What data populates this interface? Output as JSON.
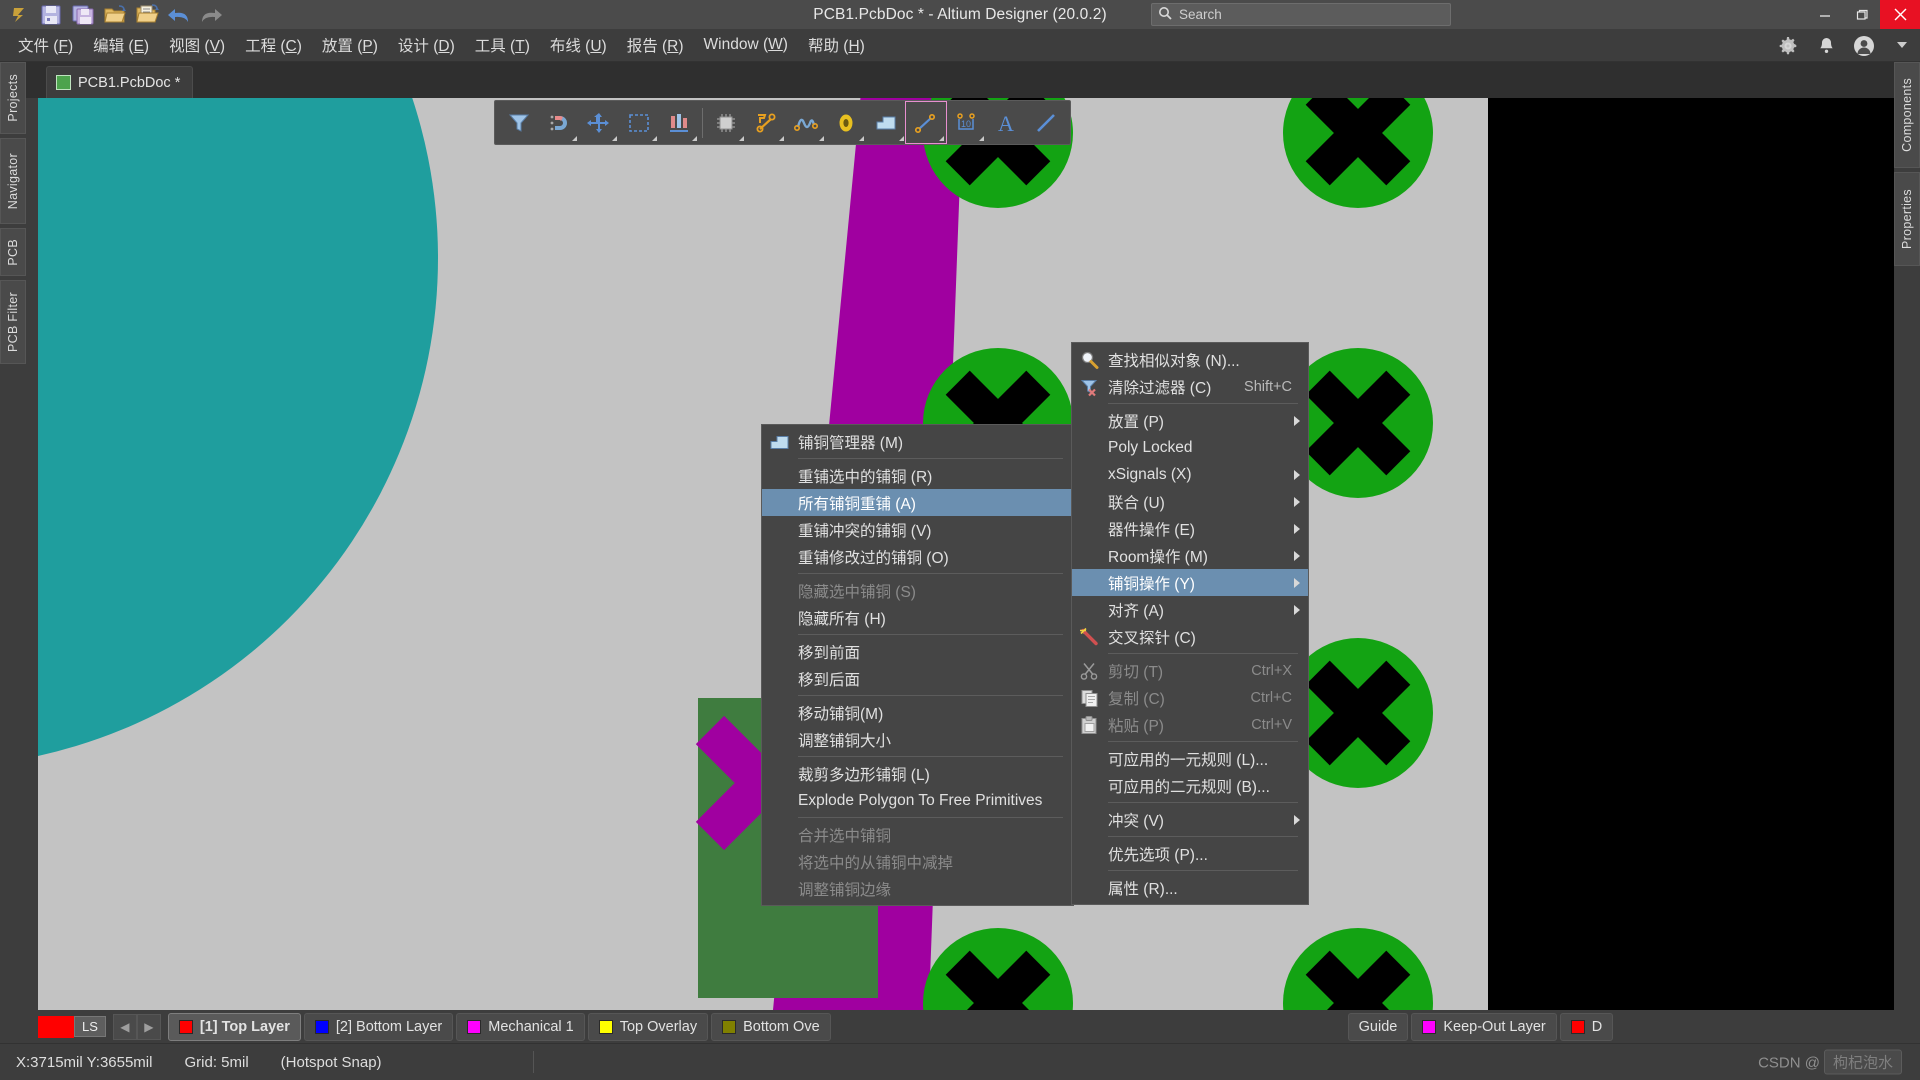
{
  "titlebar": {
    "title": "PCB1.PcbDoc * - Altium Designer (20.0.2)",
    "quick_access": [
      {
        "name": "altium-logo-icon",
        "label": "A"
      },
      {
        "name": "save-icon",
        "label": "Save"
      },
      {
        "name": "save-all-icon",
        "label": "Save All"
      },
      {
        "name": "open-folder-icon",
        "label": "Open"
      },
      {
        "name": "open-document-icon",
        "label": "Open Document"
      },
      {
        "name": "undo-icon",
        "label": "Undo"
      },
      {
        "name": "redo-icon",
        "label": "Redo"
      }
    ],
    "search_placeholder": "Search",
    "window_buttons": [
      {
        "name": "minimize-button",
        "glyph": "—"
      },
      {
        "name": "restore-button",
        "glyph": "❐"
      },
      {
        "name": "close-button",
        "glyph": "✕"
      }
    ]
  },
  "menubar": {
    "items": [
      {
        "text": "文件 (F)",
        "pre": "文件 (",
        "key": "F",
        "post": ")"
      },
      {
        "text": "编辑 (E)",
        "pre": "编辑 (",
        "key": "E",
        "post": ")"
      },
      {
        "text": "视图 (V)",
        "pre": "视图 (",
        "key": "V",
        "post": ")"
      },
      {
        "text": "工程 (C)",
        "pre": "工程 (",
        "key": "C",
        "post": ")"
      },
      {
        "text": "放置 (P)",
        "pre": "放置 (",
        "key": "P",
        "post": ")"
      },
      {
        "text": "设计 (D)",
        "pre": "设计 (",
        "key": "D",
        "post": ")"
      },
      {
        "text": "工具 (T)",
        "pre": "工具 (",
        "key": "T",
        "post": ")"
      },
      {
        "text": "布线 (U)",
        "pre": "布线 (",
        "key": "U",
        "post": ")"
      },
      {
        "text": "报告 (R)",
        "pre": "报告 (",
        "key": "R",
        "post": ")"
      },
      {
        "text": "Window (W)",
        "pre": "Window (",
        "key": "W",
        "post": ")"
      },
      {
        "text": "帮助 (H)",
        "pre": "帮助 (",
        "key": "H",
        "post": ")"
      }
    ],
    "right_icons": [
      {
        "name": "settings-gear-icon"
      },
      {
        "name": "notifications-bell-icon"
      },
      {
        "name": "user-account-icon"
      },
      {
        "name": "chevron-down-icon"
      }
    ]
  },
  "document_tab": {
    "label": "PCB1.PcbDoc *"
  },
  "left_rail": {
    "items": [
      {
        "label": "Projects",
        "name": "sidebar-item-projects"
      },
      {
        "label": "Navigator",
        "name": "sidebar-item-navigator"
      },
      {
        "label": "PCB",
        "name": "sidebar-item-pcb"
      },
      {
        "label": "PCB Filter",
        "name": "sidebar-item-pcb-filter"
      }
    ]
  },
  "right_rail": {
    "items": [
      {
        "label": "Components",
        "name": "sidebar-item-components"
      },
      {
        "label": "Properties",
        "name": "sidebar-item-properties"
      }
    ]
  },
  "float_toolbar": {
    "buttons": [
      {
        "name": "filter-icon",
        "label": "Filter",
        "selected": false,
        "caret": false
      },
      {
        "name": "snap-magnet-icon",
        "label": "Snap",
        "selected": false,
        "caret": true
      },
      {
        "name": "move-crosshair-icon",
        "label": "Move",
        "selected": false,
        "caret": true
      },
      {
        "name": "selection-rect-icon",
        "label": "Select",
        "selected": false,
        "caret": true
      },
      {
        "name": "align-icon",
        "label": "Align",
        "selected": false,
        "caret": true
      },
      {
        "name": "component-chip-icon",
        "label": "Place Component",
        "selected": false,
        "caret": true
      },
      {
        "name": "route-track-icon",
        "label": "Interactive Routing",
        "selected": false,
        "caret": true
      },
      {
        "name": "differential-pair-icon",
        "label": "Differential Pair Routing",
        "selected": false,
        "caret": true
      },
      {
        "name": "pad-via-icon",
        "label": "Place Via",
        "selected": false,
        "caret": true
      },
      {
        "name": "polygon-pour-icon",
        "label": "Place Polygon",
        "selected": false,
        "caret": true
      },
      {
        "name": "line-segment-icon",
        "label": "Place Line",
        "selected": true,
        "caret": true
      },
      {
        "name": "dimension-icon",
        "label": "Place Dimension",
        "selected": false,
        "caret": true
      },
      {
        "name": "text-string-icon",
        "label": "Place String",
        "selected": false,
        "caret": false
      },
      {
        "name": "draw-line-icon",
        "label": "Draw Line",
        "selected": false,
        "caret": false
      }
    ]
  },
  "context_menu": {
    "name": "pcb-context-menu",
    "items": [
      {
        "label": "查找相似对象 (N)...",
        "icon": "magnifier-icon",
        "disabled": false,
        "submenu": false,
        "accel": ""
      },
      {
        "label": "清除过滤器 (C)",
        "icon": "clear-filter-icon",
        "disabled": false,
        "submenu": false,
        "accel": "Shift+C"
      },
      {
        "sep": true
      },
      {
        "label": "放置 (P)",
        "icon": "",
        "disabled": false,
        "submenu": true,
        "accel": ""
      },
      {
        "label": "Poly Locked",
        "icon": "",
        "disabled": false,
        "submenu": false,
        "accel": ""
      },
      {
        "label": "xSignals (X)",
        "icon": "",
        "disabled": false,
        "submenu": true,
        "accel": ""
      },
      {
        "label": "联合 (U)",
        "icon": "",
        "disabled": false,
        "submenu": true,
        "accel": ""
      },
      {
        "label": "器件操作 (E)",
        "icon": "",
        "disabled": false,
        "submenu": true,
        "accel": ""
      },
      {
        "label": "Room操作 (M)",
        "icon": "",
        "disabled": false,
        "submenu": true,
        "accel": ""
      },
      {
        "label": "铺铜操作 (Y)",
        "icon": "",
        "disabled": false,
        "submenu": true,
        "accel": "",
        "highlighted": true
      },
      {
        "label": "对齐 (A)",
        "icon": "",
        "disabled": false,
        "submenu": true,
        "accel": ""
      },
      {
        "label": "交叉探针 (C)",
        "icon": "cross-probe-icon",
        "disabled": false,
        "submenu": false,
        "accel": ""
      },
      {
        "sep": true
      },
      {
        "label": "剪切 (T)",
        "icon": "scissors-icon",
        "disabled": true,
        "submenu": false,
        "accel": "Ctrl+X"
      },
      {
        "label": "复制 (C)",
        "icon": "copy-icon",
        "disabled": true,
        "submenu": false,
        "accel": "Ctrl+C"
      },
      {
        "label": "粘贴 (P)",
        "icon": "paste-icon",
        "disabled": true,
        "submenu": false,
        "accel": "Ctrl+V"
      },
      {
        "sep": true
      },
      {
        "label": "可应用的一元规则 (L)...",
        "icon": "",
        "disabled": false,
        "submenu": false,
        "accel": ""
      },
      {
        "label": "可应用的二元规则 (B)...",
        "icon": "",
        "disabled": false,
        "submenu": false,
        "accel": ""
      },
      {
        "sep": true
      },
      {
        "label": "冲突 (V)",
        "icon": "",
        "disabled": false,
        "submenu": true,
        "accel": ""
      },
      {
        "sep": true
      },
      {
        "label": "优先选项 (P)...",
        "icon": "",
        "disabled": false,
        "submenu": false,
        "accel": ""
      },
      {
        "sep": true
      },
      {
        "label": "属性 (R)...",
        "icon": "",
        "disabled": false,
        "submenu": false,
        "accel": ""
      }
    ]
  },
  "submenu": {
    "name": "polygon-actions-submenu",
    "items": [
      {
        "label": "铺铜管理器 (M)",
        "icon": "polygon-manager-icon",
        "disabled": false,
        "accel": ""
      },
      {
        "sep": true
      },
      {
        "label": "重铺选中的铺铜 (R)",
        "icon": "",
        "disabled": false,
        "accel": ""
      },
      {
        "label": "所有铺铜重铺 (A)",
        "icon": "",
        "disabled": false,
        "accel": "",
        "highlighted": true
      },
      {
        "label": "重铺冲突的铺铜 (V)",
        "icon": "",
        "disabled": false,
        "accel": ""
      },
      {
        "label": "重铺修改过的铺铜 (O)",
        "icon": "",
        "disabled": false,
        "accel": ""
      },
      {
        "sep": true
      },
      {
        "label": "隐藏选中铺铜 (S)",
        "icon": "",
        "disabled": true,
        "accel": ""
      },
      {
        "label": "隐藏所有 (H)",
        "icon": "",
        "disabled": false,
        "accel": ""
      },
      {
        "sep": true
      },
      {
        "label": "移到前面",
        "icon": "",
        "disabled": false,
        "accel": ""
      },
      {
        "label": "移到后面",
        "icon": "",
        "disabled": false,
        "accel": ""
      },
      {
        "sep": true
      },
      {
        "label": "移动铺铜(M)",
        "icon": "",
        "disabled": false,
        "accel": ""
      },
      {
        "label": "调整铺铜大小",
        "icon": "",
        "disabled": false,
        "accel": ""
      },
      {
        "sep": true
      },
      {
        "label": "裁剪多边形铺铜 (L)",
        "icon": "",
        "disabled": false,
        "accel": ""
      },
      {
        "label": "Explode Polygon To Free Primitives",
        "icon": "",
        "disabled": false,
        "accel": ""
      },
      {
        "sep": true
      },
      {
        "label": "合并选中铺铜",
        "icon": "",
        "disabled": true,
        "accel": ""
      },
      {
        "label": "将选中的从铺铜中减掉",
        "icon": "",
        "disabled": true,
        "accel": ""
      },
      {
        "label": "调整铺铜边缘",
        "icon": "",
        "disabled": true,
        "accel": ""
      }
    ]
  },
  "layer_bar": {
    "swatch_color": "#ff0000",
    "ls_label": "LS",
    "nav_prev": "◀",
    "nav_next": "▶",
    "tabs": [
      {
        "label": "[1] Top Layer",
        "color": "#ff0000",
        "active": true
      },
      {
        "label": "[2] Bottom Layer",
        "color": "#0000ff",
        "active": false
      },
      {
        "label": "Mechanical 1",
        "color": "#ff00ff",
        "active": false
      },
      {
        "label": "Top Overlay",
        "color": "#ffff00",
        "active": false
      },
      {
        "label": "Bottom Ove",
        "color": "#808000",
        "active": false
      },
      {
        "label": "Guide",
        "color": "#ffffff",
        "active": false
      },
      {
        "label": "Keep-Out Layer",
        "color": "#ff00ff",
        "active": false
      },
      {
        "label": "D",
        "color": "#ff0000",
        "active": false
      }
    ]
  },
  "status_bar": {
    "coordinates": "X:3715mil Y:3655mil",
    "grid": "Grid: 5mil",
    "snap": "(Hotspot Snap)",
    "watermark_prefix": "CSDN @",
    "watermark_tag": "枸杞泡水"
  },
  "colors": {
    "accent_highlight": "#6b8fb0",
    "window_bg": "#3d3d3d",
    "titlebar_bg": "#4b4b4b",
    "menu_bg": "#454545",
    "close_red": "#e81123",
    "board_gray": "#c3c3c3",
    "teal_fill": "#1f9e9e",
    "purple_poly": "#a000a0",
    "green_pad": "#13a313"
  }
}
